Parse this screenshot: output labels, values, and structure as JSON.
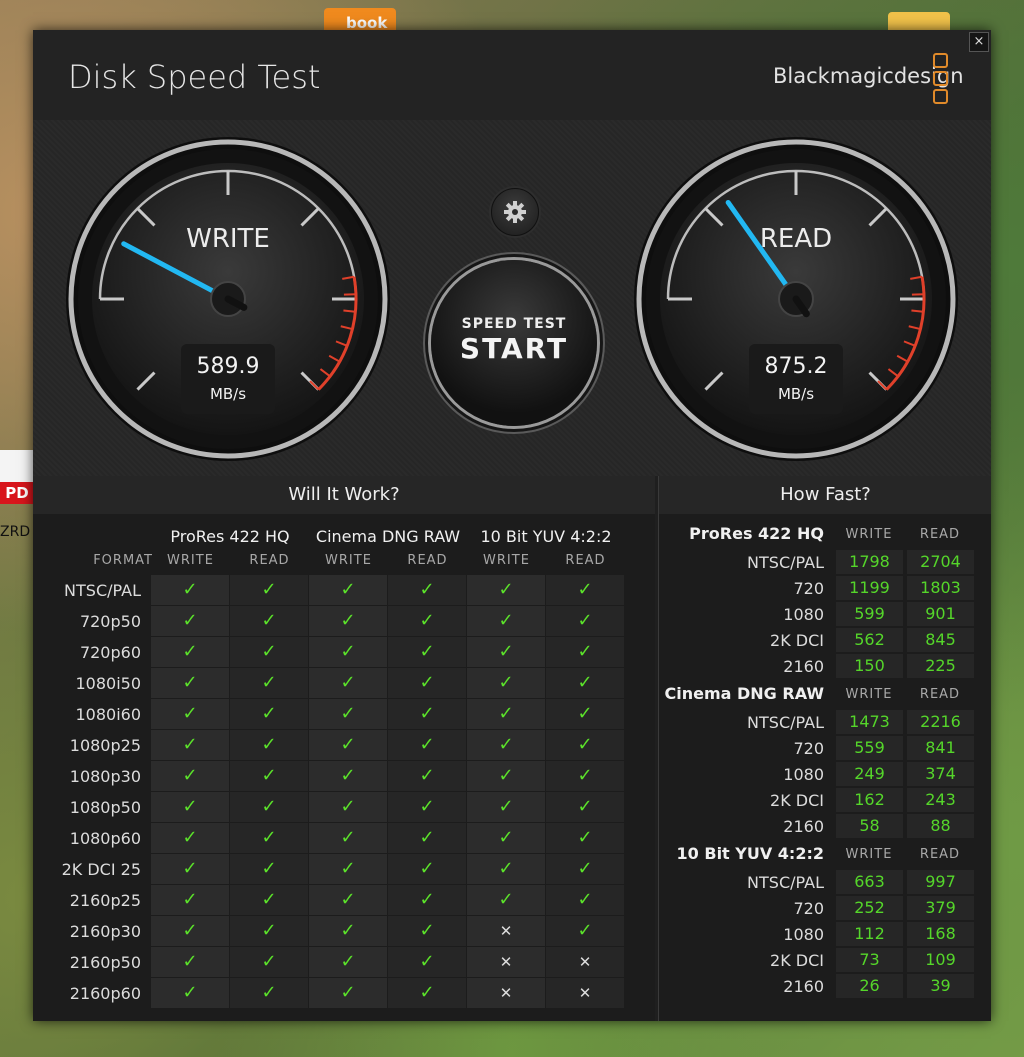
{
  "desktop": {
    "book_label": "book",
    "pdf_label": "PD",
    "zrd_label": "ZRD"
  },
  "window": {
    "title": "Disk Speed Test",
    "brand": "Blackmagicdesign",
    "close_glyph": "×"
  },
  "gauges": {
    "write": {
      "label": "WRITE",
      "value": "589.9",
      "unit": "MB/s",
      "needle_fraction": 0.27
    },
    "read": {
      "label": "READ",
      "value": "875.2",
      "unit": "MB/s",
      "needle_fraction": 0.37
    }
  },
  "controls": {
    "settings_icon": "gear-icon",
    "start_small": "SPEED TEST",
    "start_big": "START"
  },
  "will_it_work": {
    "title": "Will It Work?",
    "format_header": "FORMAT",
    "groups": [
      "ProRes 422 HQ",
      "Cinema DNG RAW",
      "10 Bit YUV 4:2:2"
    ],
    "sub_headers": [
      "WRITE",
      "READ"
    ],
    "rows": [
      {
        "format": "NTSC/PAL",
        "results": [
          true,
          true,
          true,
          true,
          true,
          true
        ]
      },
      {
        "format": "720p50",
        "results": [
          true,
          true,
          true,
          true,
          true,
          true
        ]
      },
      {
        "format": "720p60",
        "results": [
          true,
          true,
          true,
          true,
          true,
          true
        ]
      },
      {
        "format": "1080i50",
        "results": [
          true,
          true,
          true,
          true,
          true,
          true
        ]
      },
      {
        "format": "1080i60",
        "results": [
          true,
          true,
          true,
          true,
          true,
          true
        ]
      },
      {
        "format": "1080p25",
        "results": [
          true,
          true,
          true,
          true,
          true,
          true
        ]
      },
      {
        "format": "1080p30",
        "results": [
          true,
          true,
          true,
          true,
          true,
          true
        ]
      },
      {
        "format": "1080p50",
        "results": [
          true,
          true,
          true,
          true,
          true,
          true
        ]
      },
      {
        "format": "1080p60",
        "results": [
          true,
          true,
          true,
          true,
          true,
          true
        ]
      },
      {
        "format": "2K DCI 25",
        "results": [
          true,
          true,
          true,
          true,
          true,
          true
        ]
      },
      {
        "format": "2160p25",
        "results": [
          true,
          true,
          true,
          true,
          true,
          true
        ]
      },
      {
        "format": "2160p30",
        "results": [
          true,
          true,
          true,
          true,
          false,
          true
        ]
      },
      {
        "format": "2160p50",
        "results": [
          true,
          true,
          true,
          true,
          false,
          false
        ]
      },
      {
        "format": "2160p60",
        "results": [
          true,
          true,
          true,
          true,
          false,
          false
        ]
      }
    ],
    "ok_glyph": "✓",
    "no_glyph": "✕"
  },
  "how_fast": {
    "title": "How Fast?",
    "write_header": "WRITE",
    "read_header": "READ",
    "groups": [
      {
        "name": "ProRes 422 HQ",
        "rows": [
          {
            "format": "NTSC/PAL",
            "write": "1798",
            "read": "2704"
          },
          {
            "format": "720",
            "write": "1199",
            "read": "1803"
          },
          {
            "format": "1080",
            "write": "599",
            "read": "901"
          },
          {
            "format": "2K DCI",
            "write": "562",
            "read": "845"
          },
          {
            "format": "2160",
            "write": "150",
            "read": "225"
          }
        ]
      },
      {
        "name": "Cinema DNG RAW",
        "rows": [
          {
            "format": "NTSC/PAL",
            "write": "1473",
            "read": "2216"
          },
          {
            "format": "720",
            "write": "559",
            "read": "841"
          },
          {
            "format": "1080",
            "write": "249",
            "read": "374"
          },
          {
            "format": "2K DCI",
            "write": "162",
            "read": "243"
          },
          {
            "format": "2160",
            "write": "58",
            "read": "88"
          }
        ]
      },
      {
        "name": "10 Bit YUV 4:2:2",
        "rows": [
          {
            "format": "NTSC/PAL",
            "write": "663",
            "read": "997"
          },
          {
            "format": "720",
            "write": "252",
            "read": "379"
          },
          {
            "format": "1080",
            "write": "112",
            "read": "168"
          },
          {
            "format": "2K DCI",
            "write": "73",
            "read": "109"
          },
          {
            "format": "2160",
            "write": "26",
            "read": "39"
          }
        ]
      }
    ]
  },
  "colors": {
    "needle": "#22b8f2",
    "check": "#5be22a",
    "value_green": "#55d62a",
    "redline": "#e0402a",
    "brand_orange": "#e08a2a"
  }
}
